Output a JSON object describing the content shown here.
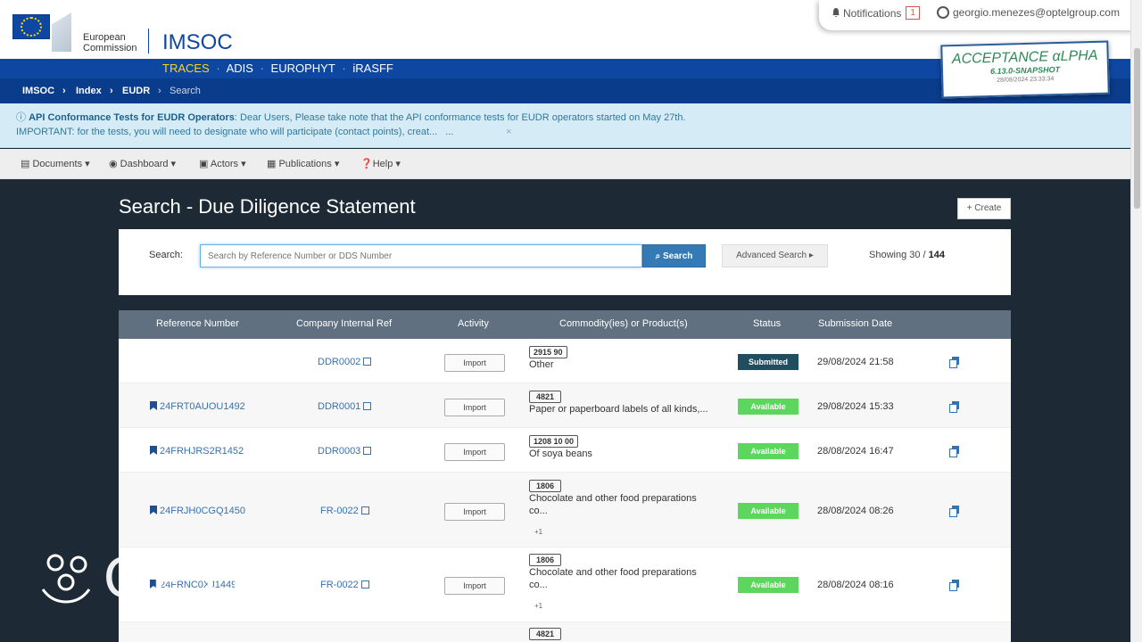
{
  "header": {
    "org_line1": "European",
    "org_line2": "Commission",
    "app_title": "IMSOC",
    "notifications_label": "Notifications",
    "notifications_count": "1",
    "user_email": "georgio.menezes@optelgroup.com"
  },
  "apps": [
    {
      "label": "TRACES",
      "active": true
    },
    {
      "label": "ADIS"
    },
    {
      "label": "EUROPHYT"
    },
    {
      "label": "iRASFF"
    }
  ],
  "breadcrumb": [
    "IMSOC",
    "Index",
    "EUDR",
    "Search"
  ],
  "environment": {
    "title": "ACCEPTANCE αLPHA",
    "version": "6.13.0-SNAPSHOT",
    "timestamp": "28/08/2024 23:33:34"
  },
  "banner": {
    "title": "API Conformance Tests for EUDR Operators",
    "text1": ": Dear Users, Please take note that the API conformance tests for EUDR operators started on May 27th.",
    "text2": "IMPORTANT: for the tests, you will need to designate who will participate (contact points), creat...",
    "ellipsis": "...",
    "close": "×"
  },
  "menu": [
    {
      "label": "Documents",
      "icon": "document-icon"
    },
    {
      "label": "Dashboard",
      "icon": "dashboard-icon"
    },
    {
      "label": "Actors",
      "icon": "actors-icon"
    },
    {
      "label": "Publications",
      "icon": "publications-icon"
    },
    {
      "label": "Help",
      "icon": "help-icon"
    }
  ],
  "page": {
    "title": "Search - Due Diligence Statement",
    "create_label": "+ Create"
  },
  "search": {
    "label": "Search:",
    "placeholder": "Search by Reference Number or DDS Number",
    "button": "Search",
    "advanced": "Advanced Search",
    "showing_prefix": "Showing 30 / ",
    "showing_total": "144"
  },
  "table": {
    "headers": [
      "Reference Number",
      "Company Internal Ref",
      "Activity",
      "Commodity(ies) or Product(s)",
      "Status",
      "Submission Date"
    ],
    "rows": [
      {
        "ref": "",
        "internal": "DDR0002",
        "activity": "Import",
        "code": "2915 90",
        "desc1": "Other",
        "desc2": "",
        "more": "",
        "status": "Submitted",
        "date": "29/08/2024 21:58"
      },
      {
        "ref": "24FRT0AUOU1492",
        "internal": "DDR0001",
        "activity": "Import",
        "code": "4821",
        "desc1": "Paper or paperboard labels of all kinds,...",
        "desc2": "",
        "more": "",
        "status": "Available",
        "date": "29/08/2024 15:33"
      },
      {
        "ref": "24FRHJRS2R1452",
        "internal": "DDR0003",
        "activity": "Import",
        "code": "1208 10 00",
        "desc1": "Of soya beans",
        "desc2": "",
        "more": "",
        "status": "Available",
        "date": "28/08/2024 16:47"
      },
      {
        "ref": "24FRJH0CGQ1450",
        "internal": "FR-0022",
        "activity": "Import",
        "code": "1806",
        "desc1": "Chocolate and other food preparations",
        "desc2": "co...",
        "more": "+1",
        "status": "Available",
        "date": "28/08/2024 08:26"
      },
      {
        "ref": "24FRNC0XJ1449",
        "internal": "FR-0022",
        "activity": "Import",
        "code": "1806",
        "desc1": "Chocolate and other food preparations",
        "desc2": "co...",
        "more": "+1",
        "status": "Available",
        "date": "28/08/2024 08:16"
      },
      {
        "ref": "",
        "internal": "",
        "activity": "",
        "code": "4821",
        "desc1": "",
        "desc2": "",
        "more": "",
        "status": "",
        "date": ""
      }
    ]
  },
  "watermark": {
    "text": "OPTEL"
  },
  "colors": {
    "brand_blue": "#0e47a1",
    "traces_yellow": "#ffd617",
    "submitted": "#1f4e5e",
    "available": "#5cd65c",
    "page_bg": "#1d2a35"
  }
}
